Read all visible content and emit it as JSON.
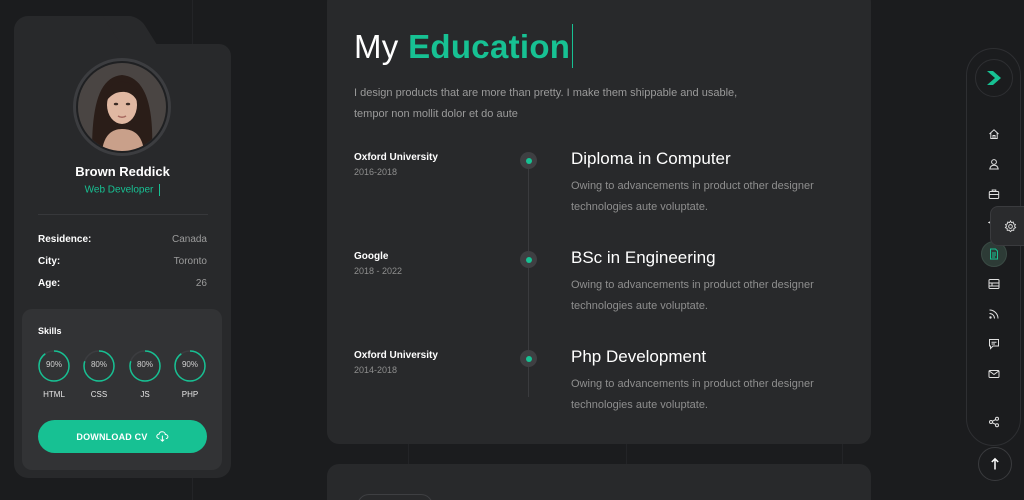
{
  "profile": {
    "name": "Brown Reddick",
    "role": "Web Developer",
    "info": [
      {
        "key": "Residence:",
        "value": "Canada"
      },
      {
        "key": "City:",
        "value": "Toronto"
      },
      {
        "key": "Age:",
        "value": "26"
      }
    ],
    "skills_title": "Skills",
    "skills": [
      {
        "name": "HTML",
        "percent_label": "90%",
        "percent": 90
      },
      {
        "name": "CSS",
        "percent_label": "80%",
        "percent": 80
      },
      {
        "name": "JS",
        "percent_label": "80%",
        "percent": 80
      },
      {
        "name": "PHP",
        "percent_label": "90%",
        "percent": 90
      }
    ],
    "download_label": "DOWNLOAD CV"
  },
  "education": {
    "title_prefix": "My ",
    "title_accent": "Education",
    "intro": "I design products that are more than pretty. I make them shippable and usable, tempor non mollit dolor et do aute",
    "items": [
      {
        "org": "Oxford University",
        "years": "2016-2018",
        "degree": "Diploma in Computer",
        "desc": "Owing to advancements in product other designer technologies aute voluptate."
      },
      {
        "org": "Google",
        "years": "2018 - 2022",
        "degree": "BSc in Engineering",
        "desc": "Owing to advancements in product other designer technologies aute voluptate."
      },
      {
        "org": "Oxford University",
        "years": "2014-2018",
        "degree": "Php Development",
        "desc": "Owing to advancements in product other designer technologies aute voluptate."
      }
    ]
  },
  "nav": {
    "items": [
      "home-icon",
      "user-icon",
      "briefcase-icon",
      "graduation-icon",
      "document-icon",
      "portfolio-icon",
      "blog-icon",
      "chat-icon",
      "mail-icon"
    ],
    "active": "document-icon",
    "share": "share-icon"
  },
  "colors": {
    "accent": "#17c193",
    "background": "#1b1c1e",
    "card": "#28292b"
  }
}
